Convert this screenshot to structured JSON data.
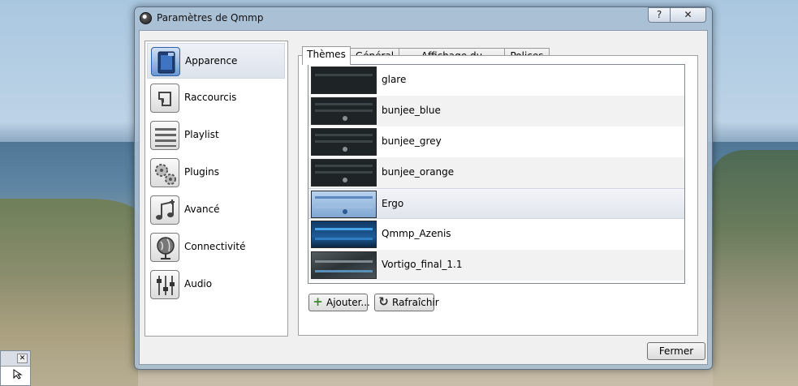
{
  "window": {
    "title": "Paramètres de Qmmp",
    "help_label": "?",
    "close_label": "✕"
  },
  "sidebar": {
    "items": [
      {
        "label": "Apparence",
        "icon": "appearance-icon",
        "active": true
      },
      {
        "label": "Raccourcis",
        "icon": "shortcuts-icon",
        "active": false
      },
      {
        "label": "Playlist",
        "icon": "playlist-icon",
        "active": false
      },
      {
        "label": "Plugins",
        "icon": "plugins-icon",
        "active": false
      },
      {
        "label": "Avancé",
        "icon": "advanced-icon",
        "active": false
      },
      {
        "label": "Connectivité",
        "icon": "connectivity-icon",
        "active": false
      },
      {
        "label": "Audio",
        "icon": "audio-icon",
        "active": false
      }
    ]
  },
  "tabs": [
    {
      "label": "Thèmes",
      "active": true
    },
    {
      "label": "Général",
      "active": false
    },
    {
      "label": "Affichage du morceau",
      "active": false
    },
    {
      "label": "Polices",
      "active": false
    }
  ],
  "themes": [
    {
      "name": "glare",
      "selected": false
    },
    {
      "name": "bunjee_blue",
      "selected": false
    },
    {
      "name": "bunjee_grey",
      "selected": false
    },
    {
      "name": "bunjee_orange",
      "selected": false
    },
    {
      "name": "Ergo",
      "selected": true
    },
    {
      "name": "Qmmp_Azenis",
      "selected": false
    },
    {
      "name": "Vortigo_final_1.1",
      "selected": false
    }
  ],
  "buttons": {
    "add_label": "Ajouter...",
    "refresh_label": "Rafraîchir",
    "close_label": "Fermer"
  },
  "taskbar_fragment": {
    "close_label": "✕"
  },
  "colors": {
    "selection": "#e1e5ec",
    "active_sidebar_icon": "#6a97d4"
  }
}
